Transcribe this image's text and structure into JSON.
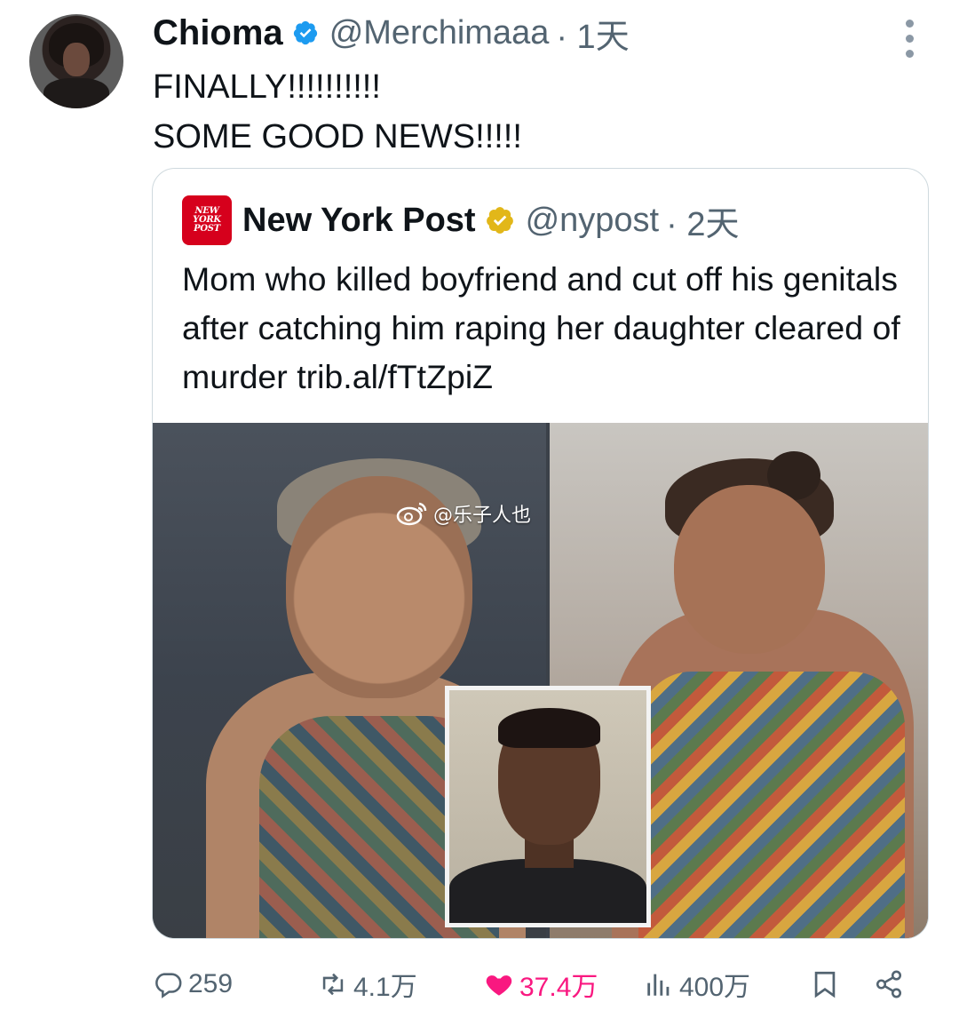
{
  "tweet": {
    "author_name": "Chioma",
    "author_handle": "@Merchimaaa",
    "time": "· 1天",
    "text_line1": "FINALLY!!!!!!!!!!",
    "text_line2": "SOME GOOD NEWS!!!!!"
  },
  "quote": {
    "logo_text": [
      "NEW",
      "YORK",
      "POST"
    ],
    "author_name": "New York Post",
    "author_handle": "@nypost",
    "time": "· 2天",
    "text": "Mom who killed boyfriend and cut off his genitals after catching him raping her daughter cleared of murder trib.al/fTtZpiZ",
    "watermark": "@乐子人也"
  },
  "actions": {
    "reply_count": "259",
    "retweet_count": "4.1万",
    "like_count": "37.4万",
    "views_count": "400万"
  },
  "colors": {
    "verified_blue": "#1d9bf0",
    "verified_gold": "#e2b719",
    "like_pink": "#f91880",
    "secondary_text": "#536471"
  },
  "icons": [
    "verified-badge-icon",
    "more-icon",
    "reply-icon",
    "retweet-icon",
    "like-icon",
    "views-icon",
    "bookmark-icon",
    "share-icon",
    "weibo-logo-icon"
  ]
}
